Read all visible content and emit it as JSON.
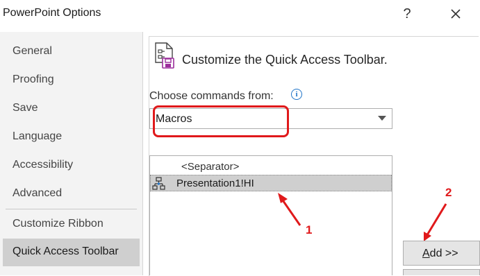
{
  "window": {
    "title": "PowerPoint Options",
    "help_label": "?",
    "close_label": "✕"
  },
  "sidebar": {
    "items": [
      {
        "label": "General"
      },
      {
        "label": "Proofing"
      },
      {
        "label": "Save"
      },
      {
        "label": "Language"
      },
      {
        "label": "Accessibility"
      },
      {
        "label": "Advanced"
      },
      {
        "label": "Customize Ribbon"
      },
      {
        "label": "Quick Access Toolbar",
        "active": true
      }
    ]
  },
  "main": {
    "heading": "Customize the Quick Access Toolbar.",
    "choose_label": "Choose commands from:",
    "info_glyph": "i",
    "commands_source": "Macros",
    "commands_list": [
      {
        "label": "<Separator>"
      },
      {
        "label": "Presentation1!HI",
        "selected": true
      }
    ],
    "add_button": "Add >>"
  },
  "annotations": [
    {
      "label": "1"
    },
    {
      "label": "2"
    }
  ],
  "colors": {
    "annotation_red": "#e0191b",
    "active_item_bg": "#cfcfcf",
    "info_blue": "#1e73c8"
  },
  "icons": [
    "qat-customize-icon",
    "info-icon",
    "dropdown-arrow-icon",
    "macro-icon"
  ]
}
